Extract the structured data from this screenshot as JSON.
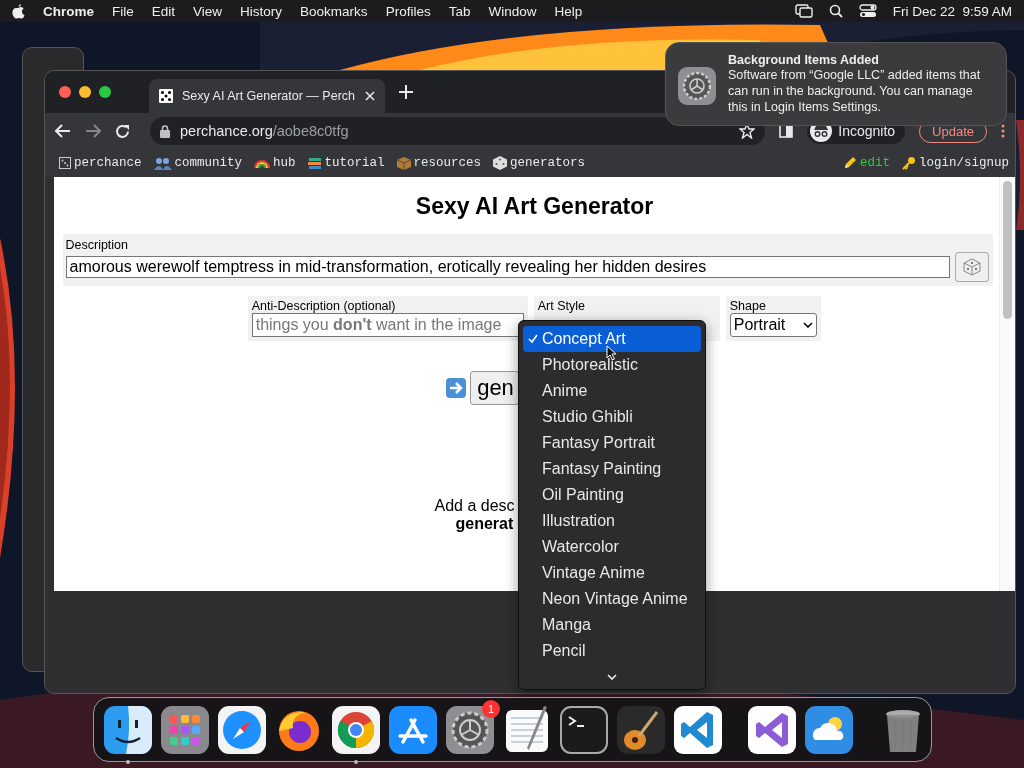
{
  "menu_bar": {
    "app": "Chrome",
    "items": [
      "File",
      "Edit",
      "View",
      "History",
      "Bookmarks",
      "Profiles",
      "Tab",
      "Window",
      "Help"
    ],
    "clock": "Fri Dec 22  9:59 AM"
  },
  "browser": {
    "tab": {
      "title": "Sexy AI Art Generator — Perch"
    },
    "url_host": "perchance.org",
    "url_path": "/aobe8c0tfg",
    "profile": "Incognito",
    "update_button": "Update",
    "bookmarks": [
      {
        "kind": "perchance",
        "label": "perchance"
      },
      {
        "kind": "community",
        "label": "community"
      },
      {
        "kind": "hub",
        "label": "hub"
      },
      {
        "kind": "tutorial",
        "label": "tutorial"
      },
      {
        "kind": "resources",
        "label": "resources"
      },
      {
        "kind": "generators",
        "label": "generators"
      }
    ],
    "bookmarks_right": [
      {
        "kind": "edit",
        "label": "edit",
        "color": "#2ecc40"
      },
      {
        "kind": "login",
        "label": "login/signup",
        "color": "#e8eaed"
      }
    ]
  },
  "page": {
    "title": "Sexy AI Art Generator",
    "description": {
      "label": "Description",
      "value": "amorous werewolf temptress in mid-transformation, erotically revealing her hidden desires"
    },
    "anti_description": {
      "label": "Anti-Description (optional)",
      "placeholder": "things you **don't** want in the image"
    },
    "art_style": {
      "label": "Art Style"
    },
    "shape": {
      "label": "Shape",
      "value": "Portrait"
    },
    "generate_button": "gen",
    "hint_lines": [
      "Add a desc",
      "generat"
    ]
  },
  "dropdown": {
    "items": [
      {
        "label": "Concept Art",
        "selected": true
      },
      {
        "label": "Photorealistic",
        "selected": false
      },
      {
        "label": "Anime",
        "selected": false
      },
      {
        "label": "Studio Ghibli",
        "selected": false
      },
      {
        "label": "Fantasy Portrait",
        "selected": false
      },
      {
        "label": "Fantasy Painting",
        "selected": false
      },
      {
        "label": "Oil Painting",
        "selected": false
      },
      {
        "label": "Illustration",
        "selected": false
      },
      {
        "label": "Watercolor",
        "selected": false
      },
      {
        "label": "Vintage Anime",
        "selected": false
      },
      {
        "label": "Neon Vintage Anime",
        "selected": false
      },
      {
        "label": "Manga",
        "selected": false
      },
      {
        "label": "Pencil",
        "selected": false
      }
    ]
  },
  "notification": {
    "title": "Background Items Added",
    "body": "Software from “Google LLC” added items that can run in the background. You can manage this in Login Items Settings."
  },
  "dock": {
    "groups": [
      {
        "apps": [
          {
            "kind": "finder",
            "running": true
          },
          {
            "kind": "launchpad",
            "running": false
          },
          {
            "kind": "safari",
            "running": false
          },
          {
            "kind": "firefox",
            "running": false
          },
          {
            "kind": "chrome",
            "running": true
          },
          {
            "kind": "appstore",
            "running": false
          },
          {
            "kind": "settings",
            "running": false,
            "badge": "1"
          },
          {
            "kind": "textedit",
            "running": false
          },
          {
            "kind": "terminal",
            "running": false
          },
          {
            "kind": "garageband",
            "running": false
          },
          {
            "kind": "vscode",
            "running": false
          }
        ]
      },
      {
        "apps": [
          {
            "kind": "visualstudio",
            "running": false
          },
          {
            "kind": "weather",
            "running": false
          }
        ]
      },
      {
        "apps": [
          {
            "kind": "trash",
            "running": false
          }
        ]
      }
    ]
  }
}
